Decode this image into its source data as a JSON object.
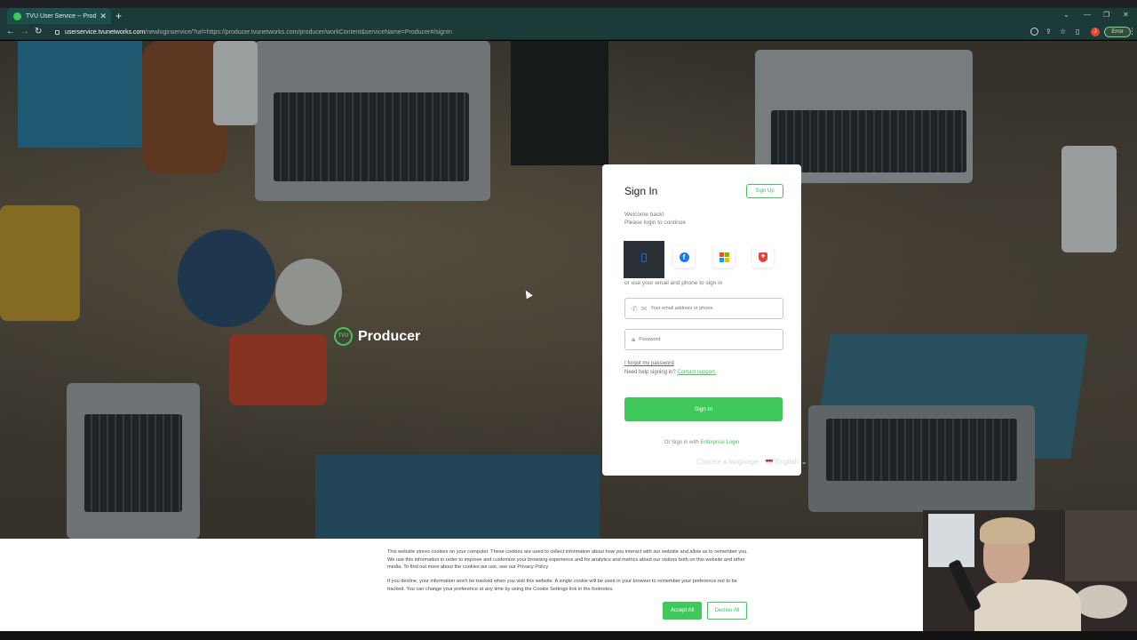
{
  "browser": {
    "tab_title": "TVU User Service -- Producer",
    "url_host": "userservice.tvunetworks.com",
    "url_path": "/newloginservice/?url=https://producer.tvunetworks.com/producer/workContent&serviceName=Producer#/signIn",
    "error_label": "Error",
    "profile_initial": "J"
  },
  "brand": {
    "mark": "TVU",
    "name": "Producer"
  },
  "signin": {
    "title": "Sign In",
    "signup_label": "Sign Up",
    "welcome_line1": "Welcome back!",
    "welcome_line2": "Please login to continue",
    "or_use_text": "or use your email and phone to sign in",
    "email_placeholder": "Your email address or phone",
    "password_placeholder": "Password",
    "forgot_label": "I forgot my password",
    "help_text": "Need help signing in?",
    "contact_label": "Contact support.",
    "signin_button": "Sign In",
    "enterprise_prefix": "Or Sign in with",
    "enterprise_link": "Enterprise Login"
  },
  "language": {
    "label": "Choose a language:",
    "selected": "English"
  },
  "cookie": {
    "paragraph1": "This website stores cookies on your computer. These cookies are used to collect information about how you interact with our website and allow us to remember you. We use this information in order to improve and customize your browsing experience and for analytics and metrics about our visitors both on this website and other media. To find out more about the cookies we use, see our Privacy Policy",
    "paragraph2": "If you decline, your information won't be tracked when you visit this website. A single cookie will be used in your browser to remember your preference not to be tracked. You can change your preference at any time by using the Cookie Settings link in the footnotes.",
    "accept_label": "Accept All",
    "decline_label": "Decline All"
  },
  "colors": {
    "accent": "#3ec95a",
    "chrome": "#1b3a38"
  },
  "icons": [
    "back-icon",
    "forward-icon",
    "reload-icon",
    "lock-icon",
    "phone-icon",
    "mail-icon",
    "password-lock-icon",
    "facebook-icon",
    "microsoft-icon",
    "shield-icon",
    "qr-icon"
  ]
}
